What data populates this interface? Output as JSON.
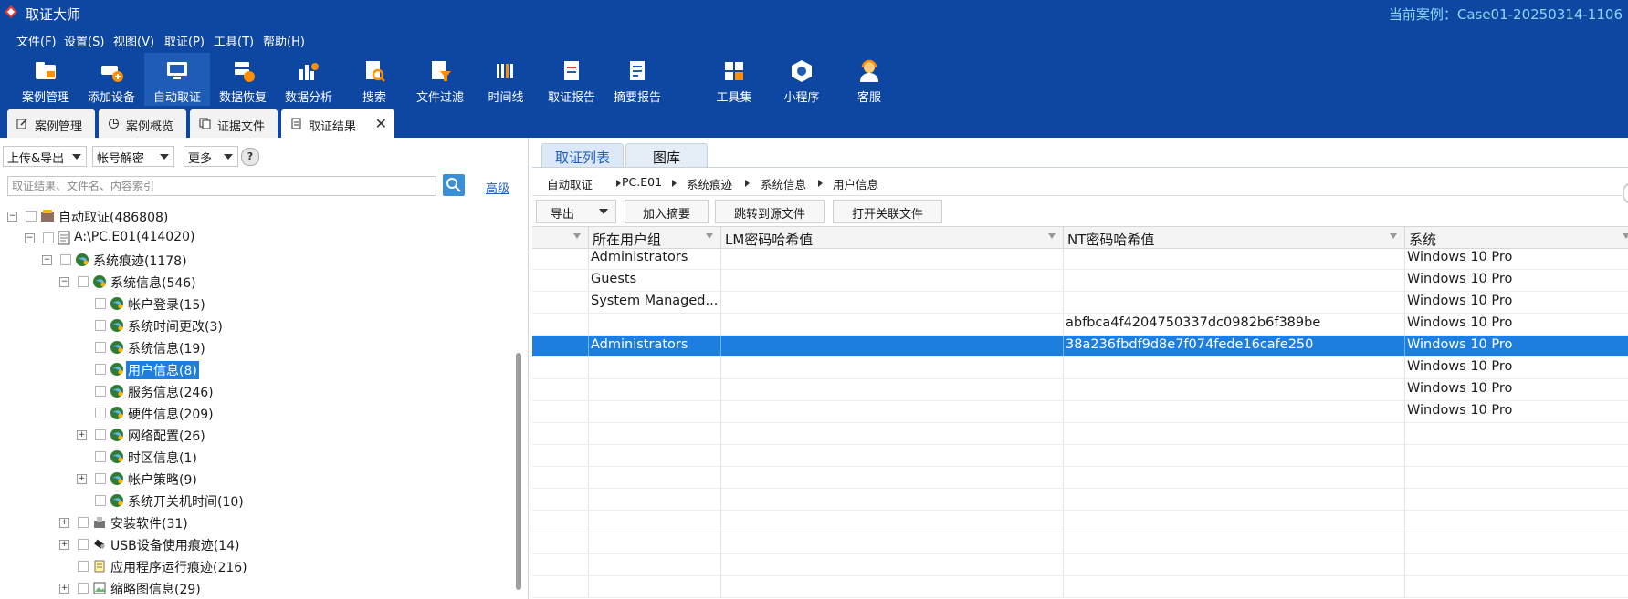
{
  "window": {
    "title": "取证大师",
    "current_case": "当前案例：Case01-20250314-1106"
  },
  "menu": [
    "文件(F)",
    "设置(S)",
    "视图(V)",
    "取证(P)",
    "工具(T)",
    "帮助(H)"
  ],
  "toolbar": [
    "案例管理",
    "添加设备",
    "自动取证",
    "数据恢复",
    "数据分析",
    "搜索",
    "文件过滤",
    "时间线",
    "取证报告",
    "摘要报告",
    "工具集",
    "小程序",
    "客服"
  ],
  "tabs": [
    "案例管理",
    "案例概览",
    "证据文件",
    "取证结果"
  ],
  "left": {
    "dropdowns": [
      "上传&导出",
      "帐号解密",
      "更多"
    ],
    "help": "?",
    "search_placeholder": "取证结果、文件名、内容索引",
    "advanced": "高级",
    "tree": [
      "自动取证(486808)",
      "A:\\PC.E01(414020)",
      "系统痕迹(1178)",
      "系统信息(546)",
      "帐户登录(15)",
      "系统时间更改(3)",
      "系统信息(19)",
      "用户信息(8)",
      "服务信息(246)",
      "硬件信息(209)",
      "网络配置(26)",
      "时区信息(1)",
      "帐户策略(9)",
      "系统开关机时间(10)",
      "安装软件(31)",
      "USB设备使用痕迹(14)",
      "应用程序运行痕迹(216)",
      "缩略图信息(29)"
    ]
  },
  "right": {
    "tabs": [
      "取证列表",
      "图库"
    ],
    "breadcrumb": [
      "自动取证",
      "PC.E01",
      "系统痕迹",
      "系统信息",
      "用户信息"
    ],
    "buttons": [
      "导出",
      "加入摘要",
      "跳转到源文件",
      "打开关联文件"
    ],
    "columns": [
      "",
      "所在用户组",
      "LM密码哈希值",
      "NT密码哈希值",
      "系统"
    ],
    "rows": [
      [
        "",
        "Administrators",
        "",
        "",
        "Windows 10 Pro"
      ],
      [
        "",
        "Guests",
        "",
        "",
        "Windows 10 Pro"
      ],
      [
        "",
        "System Managed...",
        "",
        "",
        "Windows 10 Pro"
      ],
      [
        "",
        "",
        "",
        "abfbca4f4204750337dc0982b6f389be",
        "Windows 10 Pro"
      ],
      [
        "",
        "Administrators",
        "",
        "38a236fbdf9d8e7f074fede16cafe250",
        "Windows 10 Pro"
      ],
      [
        "",
        "",
        "",
        "",
        "Windows 10 Pro"
      ],
      [
        "",
        "",
        "",
        "",
        "Windows 10 Pro"
      ],
      [
        "",
        "",
        "",
        "",
        "Windows 10 Pro"
      ]
    ],
    "selected_row": 4
  },
  "colors": {
    "chrome": "#0d47a1",
    "selection": "#1e7ee0",
    "case_text": "#8fd3ff"
  }
}
